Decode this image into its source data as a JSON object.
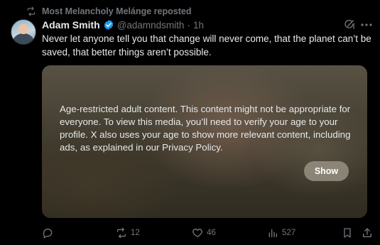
{
  "repost": {
    "text": "Most Melancholy Melánge reposted",
    "icon": "repost-icon"
  },
  "author": {
    "name": "Adam Smith",
    "handle": "@adamndsmith",
    "separator": "·",
    "time": "1h",
    "verified": true,
    "verified_color": "#1d9bf0"
  },
  "tweet": {
    "text": "Never let anyone tell you that change will never come, that the planet can’t be saved, that better things aren’t possible."
  },
  "media": {
    "warning": "Age-restricted adult content. This content might not be appropriate for everyone. To view this media, you’ll need to verify your age to your profile. X also uses your age to show more relevant content, including ads, as explained in our Privacy Policy.",
    "show_label": "Show"
  },
  "actions": {
    "replies": "",
    "reposts": "12",
    "likes": "46",
    "views": "527"
  },
  "colors": {
    "background": "#000000",
    "text": "#e7e9ea",
    "muted": "#71767b",
    "accent": "#1d9bf0"
  }
}
